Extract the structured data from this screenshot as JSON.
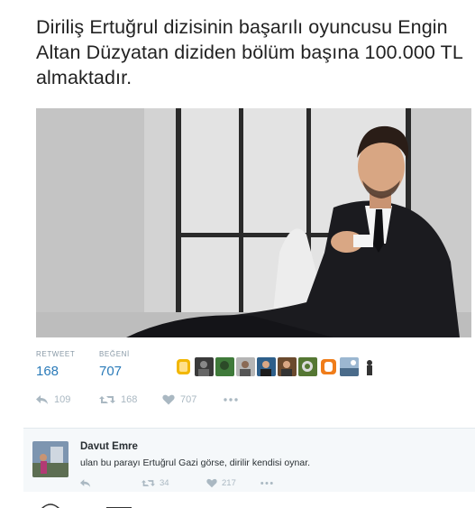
{
  "tweet": {
    "text": "Diriliş Ertuğrul dizisinin başarılı oyuncusu Engin Altan Düzyatan diziden bölüm başına 100.000 TL almaktadır."
  },
  "stats": {
    "retweet_label": "RETWEET",
    "retweet_count": "168",
    "likes_label": "BEĞENİ",
    "likes_count": "707"
  },
  "likers": [
    {
      "icon": "avatar-yellow",
      "color": "#f2b705"
    },
    {
      "icon": "avatar-dark",
      "color": "#3a3a3a"
    },
    {
      "icon": "avatar-green",
      "color": "#3f7a3a"
    },
    {
      "icon": "avatar-grey",
      "color": "#9a9a9a"
    },
    {
      "icon": "avatar-blue",
      "color": "#2e5f8a"
    },
    {
      "icon": "avatar-brown",
      "color": "#6b4a2e"
    },
    {
      "icon": "avatar-photo",
      "color": "#557733"
    },
    {
      "icon": "avatar-orange",
      "color": "#f07d1a"
    },
    {
      "icon": "avatar-landscape",
      "color": "#4a6b8a"
    },
    {
      "icon": "avatar-figure",
      "color": "#dddddd"
    }
  ],
  "actions": {
    "reply_count": "109",
    "retweet_count": "168",
    "like_count": "707"
  },
  "reply": {
    "name": "Davut Emre",
    "text": "ulan bu parayı Ertuğrul Gazi görse, dirilir kendisi oynar.",
    "retweet_count": "34",
    "like_count": "217"
  },
  "colors": {
    "accent": "#2b7bb9",
    "muted": "#aab8c2",
    "reply_bg": "#f5f8fa"
  }
}
